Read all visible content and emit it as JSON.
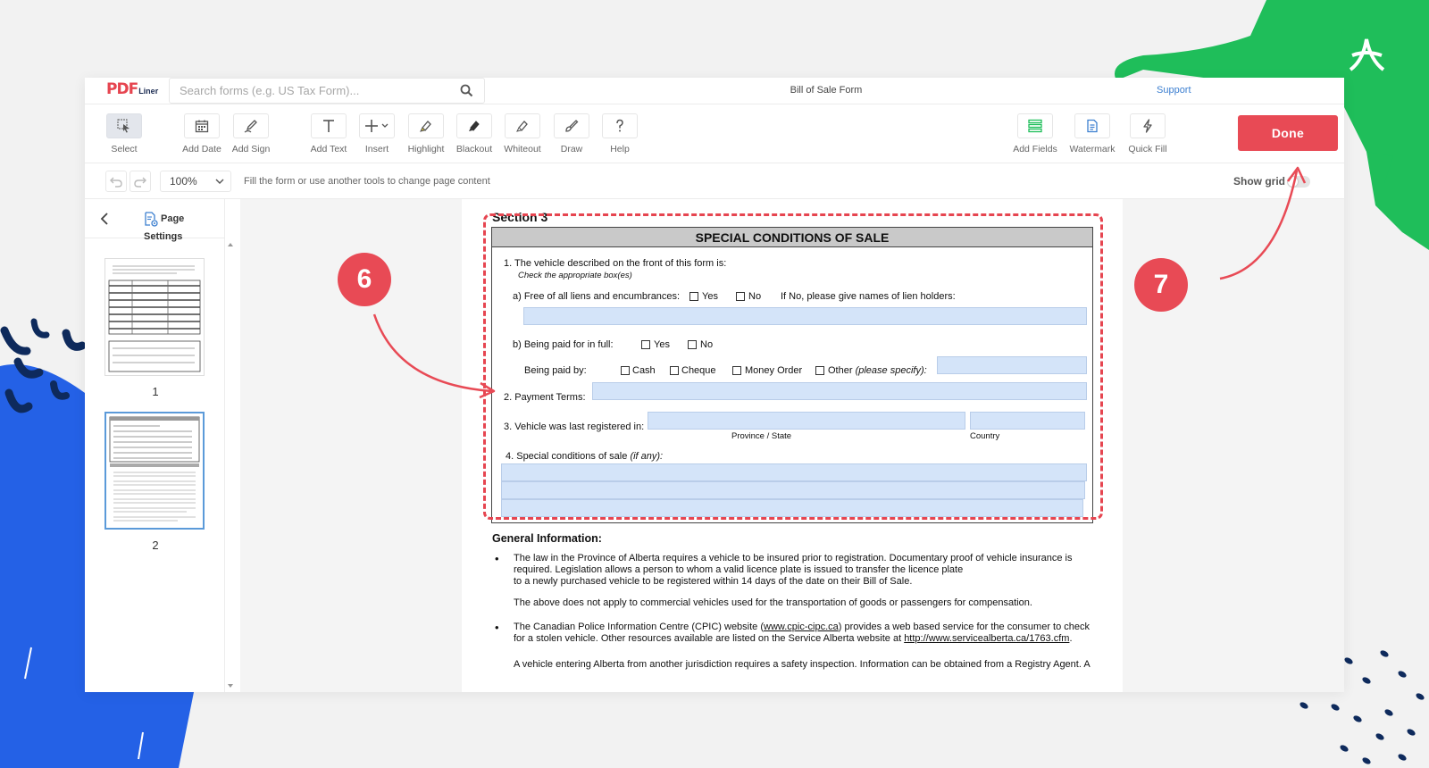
{
  "app": {
    "logo_main": "PDF",
    "logo_sub": "Liner",
    "search_placeholder": "Search forms (e.g. US Tax Form)...",
    "document_title": "Bill of Sale Form",
    "support_link": "Support"
  },
  "toolbar": {
    "tools": {
      "select": "Select",
      "add_date": "Add Date",
      "add_sign": "Add Sign",
      "add_text": "Add Text",
      "insert": "Insert",
      "highlight": "Highlight",
      "blackout": "Blackout",
      "whiteout": "Whiteout",
      "draw": "Draw",
      "help": "Help",
      "add_fields": "Add Fields",
      "watermark": "Watermark",
      "quick_fill": "Quick Fill"
    },
    "done_label": "Done"
  },
  "subbar": {
    "zoom_value": "100%",
    "hint": "Fill the form or use another tools to change page content",
    "show_grid": "Show grid"
  },
  "sidebar": {
    "page_settings": "Page Settings",
    "pages": [
      "1",
      "2"
    ],
    "selected_page": "2"
  },
  "document": {
    "section_title": "Section 3",
    "box_title": "SPECIAL CONDITIONS OF SALE",
    "q1": "1. The vehicle described on the front of this form is:",
    "q1_hint": "Check the appropriate box(es)",
    "q1a": "a) Free of all liens and encumbrances:",
    "yes": "Yes",
    "no": "No",
    "lien_holders": "If No, please give names of lien holders:",
    "q1b": "b) Being paid for in full:",
    "paid_by": "Being paid by:",
    "cash": "Cash",
    "cheque": "Cheque",
    "money_order": "Money Order",
    "other": "Other",
    "other_hint": "(please specify):",
    "q2": "2. Payment Terms:",
    "q3": "3. Vehicle was last registered in:",
    "province_state": "Province / State",
    "country": "Country",
    "q4": "4. Special conditions of sale",
    "q4_hint": "(if any):",
    "general_title": "General Information:",
    "bullet1": "The law in the Province of Alberta requires a vehicle to be insured prior to registration. Documentary proof of vehicle insurance is required. Legislation allows a person to whom a valid licence plate is issued to transfer the licence plate to a newly purchased vehicle to be registered within 14 days of the date on their Bill of Sale.",
    "bullet1_line1": "The law in the Province of Alberta requires a vehicle to be insured prior to registration. Documentary proof of vehicle insurance is",
    "bullet1_line2": "required. Legislation allows a person to whom a valid licence plate is issued to transfer the licence plate",
    "bullet1_line3": "to a newly purchased vehicle to be registered within 14 days of the date on their Bill of Sale.",
    "para2": "The above does not apply to commercial vehicles used for the transportation of goods or passengers for compensation.",
    "bullet2_a": "The Canadian Police Information Centre (CPIC) website (",
    "bullet2_link1": "www.cpic-cipc.ca",
    "bullet2_b": ") provides a web based service for the consumer to check",
    "bullet2_c": "for a stolen vehicle. Other resources available are listed on the Service Alberta website at ",
    "bullet2_link2": "http://www.servicealberta.ca/1763.cfm",
    "bullet2_d": ".",
    "bullet3": "A vehicle entering Alberta from another jurisdiction requires a safety inspection. Information can be obtained from a Registry Agent. A"
  },
  "callouts": {
    "step_6": "6",
    "step_7": "7"
  },
  "colors": {
    "accent": "#e84a55",
    "field_fill": "#d4e4f9",
    "link": "#3c7fd0",
    "deco_green": "#1fbe5a",
    "deco_blue": "#2461e6"
  }
}
